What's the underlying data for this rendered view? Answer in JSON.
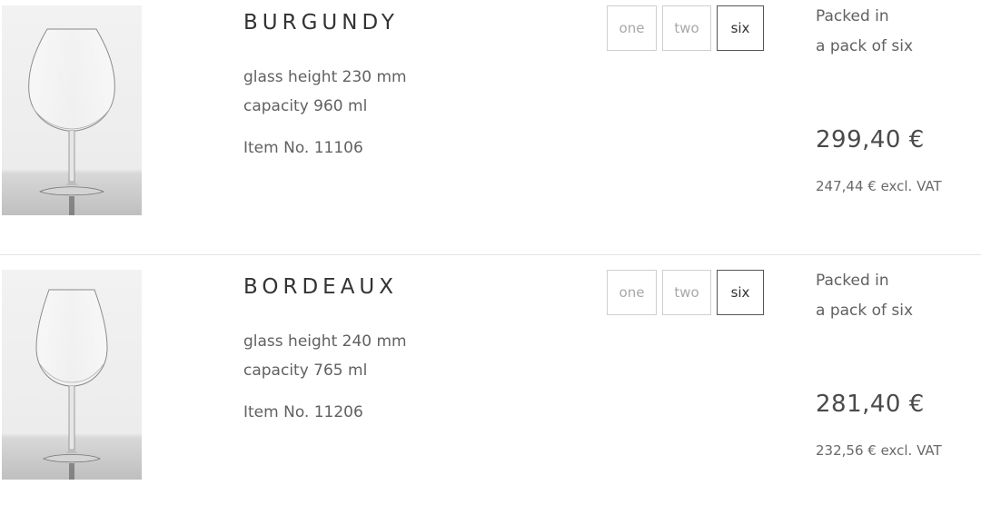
{
  "products": [
    {
      "name": "BURGUNDY",
      "glass_height": "glass height 230 mm",
      "capacity": "capacity 960 ml",
      "item_no": "Item No. 11106",
      "quantity_options": [
        "one",
        "two",
        "six"
      ],
      "selected_quantity": "six",
      "packed_line1": "Packed in",
      "packed_line2": "a pack of six",
      "price": "299,40 €",
      "price_excl_vat": "247,44 € excl. VAT",
      "image_icon": "burgundy-wine-glass"
    },
    {
      "name": "BORDEAUX",
      "glass_height": "glass height 240 mm",
      "capacity": "capacity 765 ml",
      "item_no": "Item No. 11206",
      "quantity_options": [
        "one",
        "two",
        "six"
      ],
      "selected_quantity": "six",
      "packed_line1": "Packed in",
      "packed_line2": "a pack of six",
      "price": "281,40 €",
      "price_excl_vat": "232,56 € excl. VAT",
      "image_icon": "bordeaux-wine-glass"
    }
  ],
  "colors": {
    "selected_border": "#555555",
    "unselected_border": "#cfcfcf",
    "unselected_text": "#a8a8a8",
    "divider": "#e4e4e4"
  }
}
